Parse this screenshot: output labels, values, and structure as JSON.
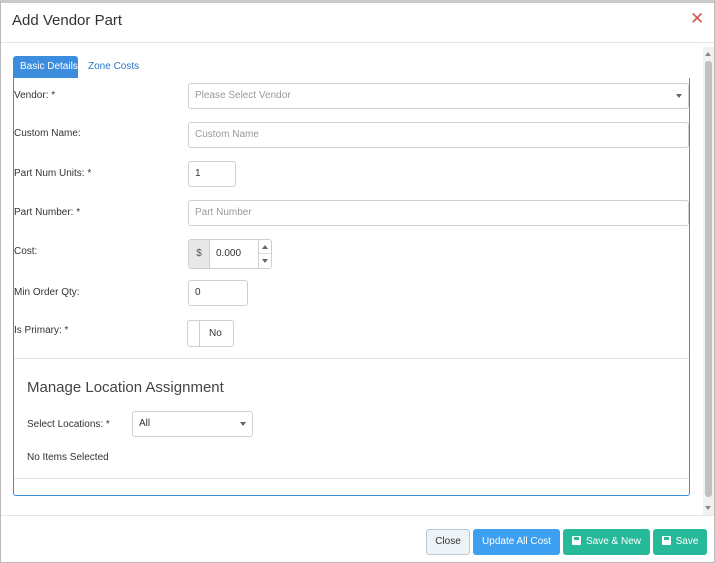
{
  "dialog": {
    "title": "Add Vendor Part",
    "close_icon": "close-x-icon",
    "close_color": "#d9534f"
  },
  "tabs": [
    {
      "label": "Basic Details",
      "active": true
    },
    {
      "label": "Zone Costs",
      "active": false
    }
  ],
  "form": {
    "vendor": {
      "label": "Vendor: *",
      "placeholder": "Please Select Vendor"
    },
    "custom_name": {
      "label": "Custom Name:",
      "placeholder": "Custom Name"
    },
    "part_num_units": {
      "label": "Part Num Units: *",
      "value": "1"
    },
    "part_number": {
      "label": "Part Number: *",
      "placeholder": "Part Number"
    },
    "cost": {
      "label": "Cost:",
      "prefix": "$",
      "value": "0.000"
    },
    "min_order_qty": {
      "label": "Min Order Qty:",
      "value": "0"
    },
    "is_primary": {
      "label": "Is Primary: *",
      "value": "No"
    }
  },
  "locations": {
    "title": "Manage Location Assignment",
    "select_label": "Select Locations: *",
    "select_value": "All",
    "empty_text": "No Items Selected"
  },
  "footer": {
    "close": "Close",
    "update_all_cost": "Update All Cost",
    "save_new": "Save & New",
    "save": "Save"
  },
  "colors": {
    "primary": "#3c8dde",
    "success": "#26b99a",
    "danger": "#d9534f"
  }
}
